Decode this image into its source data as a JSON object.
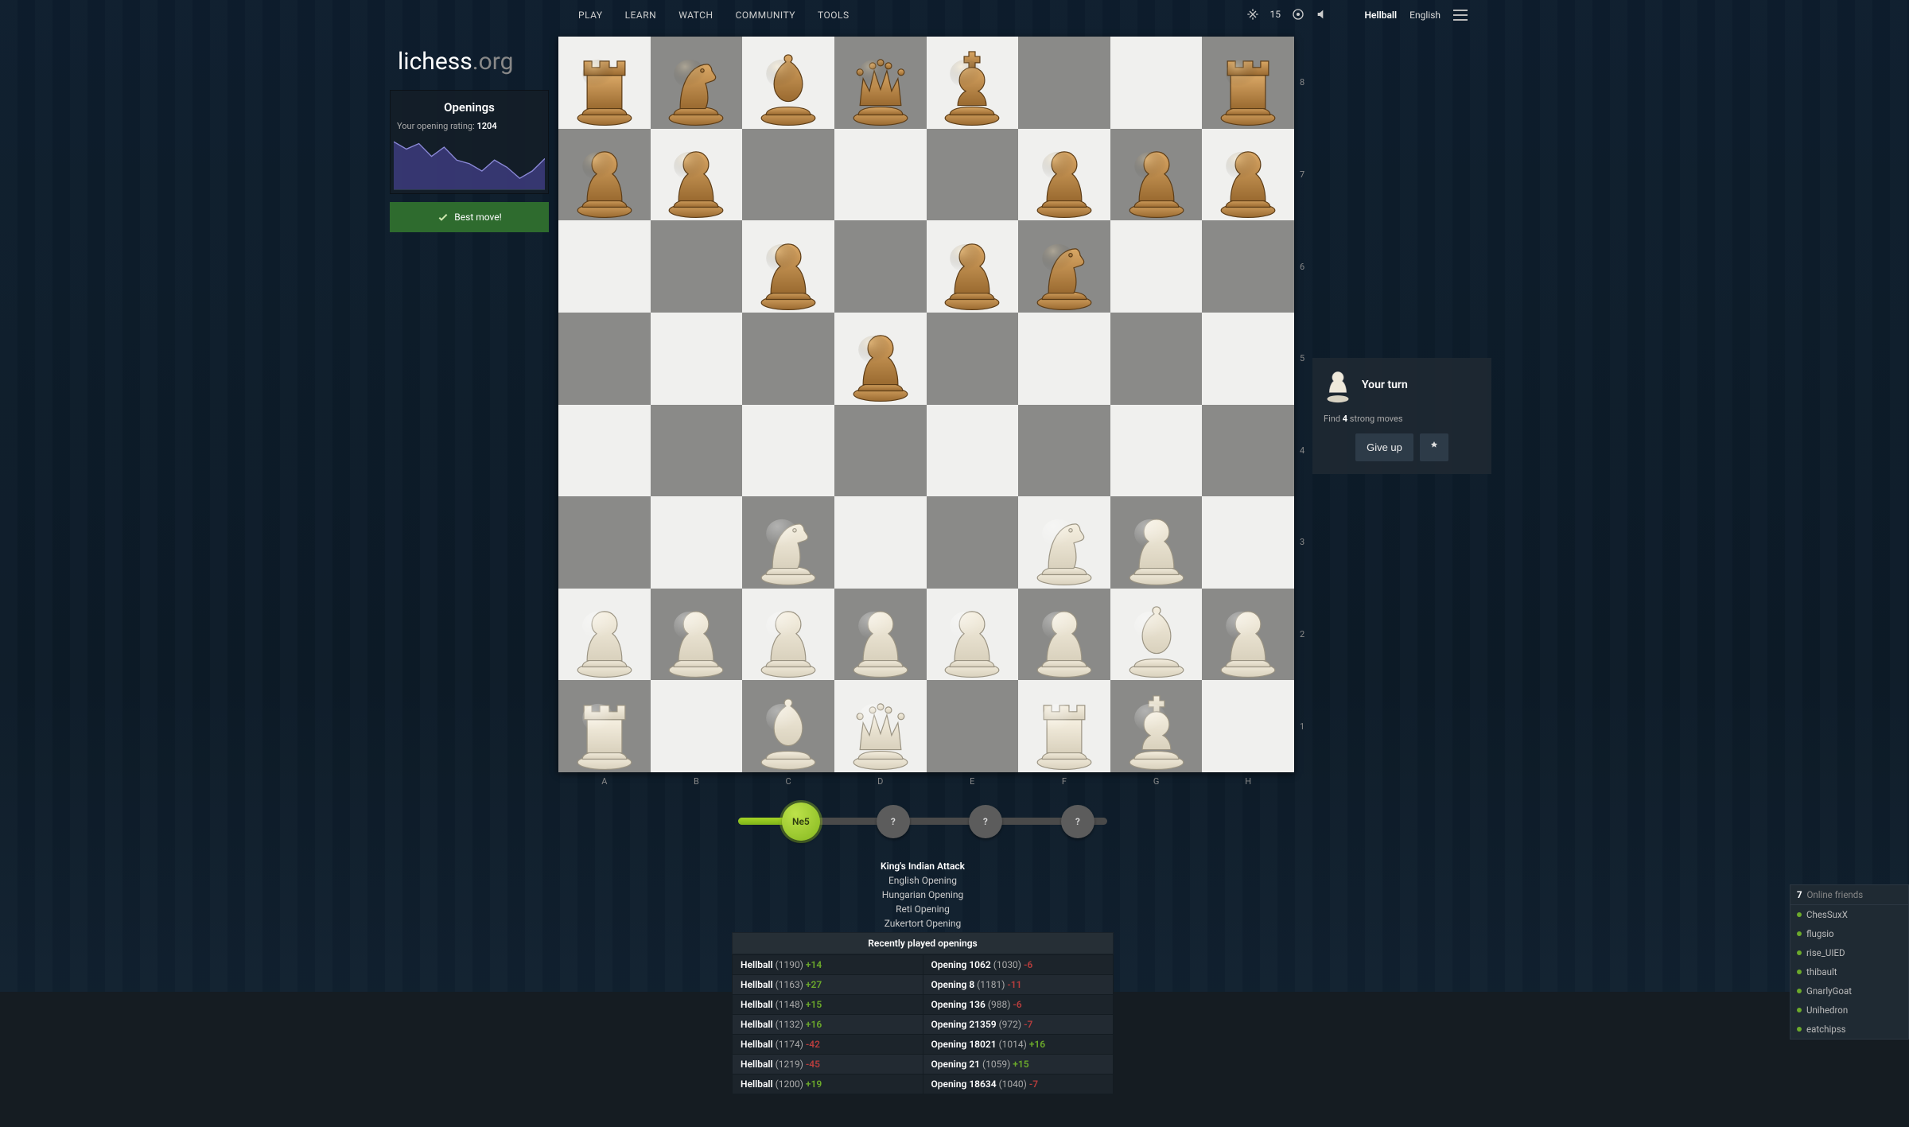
{
  "nav": {
    "items": [
      "PLAY",
      "LEARN",
      "WATCH",
      "COMMUNITY",
      "TOOLS"
    ],
    "challenges": "15",
    "username": "Hellball",
    "language": "English"
  },
  "logo": {
    "main": "lichess",
    "suffix": ".org"
  },
  "left": {
    "title": "Openings",
    "rating_label": "Your opening rating: ",
    "rating_value": "1204",
    "bestmove": "Best move!"
  },
  "board": {
    "files": [
      "A",
      "B",
      "C",
      "D",
      "E",
      "F",
      "G",
      "H"
    ],
    "ranks": [
      "8",
      "7",
      "6",
      "5",
      "4",
      "3",
      "2",
      "1"
    ],
    "position_fen": "rnbqk2r/pp3ppp/2p1pn2/3p4/8/2N2NP1/PPPPPPBP/R1BQ1RK1",
    "pieces": [
      {
        "t": "r",
        "c": "b",
        "sq": "a8"
      },
      {
        "t": "n",
        "c": "b",
        "sq": "b8"
      },
      {
        "t": "b",
        "c": "b",
        "sq": "c8"
      },
      {
        "t": "q",
        "c": "b",
        "sq": "d8"
      },
      {
        "t": "k",
        "c": "b",
        "sq": "e8"
      },
      {
        "t": "r",
        "c": "b",
        "sq": "h8"
      },
      {
        "t": "p",
        "c": "b",
        "sq": "a7"
      },
      {
        "t": "p",
        "c": "b",
        "sq": "b7"
      },
      {
        "t": "p",
        "c": "b",
        "sq": "f7"
      },
      {
        "t": "p",
        "c": "b",
        "sq": "g7"
      },
      {
        "t": "p",
        "c": "b",
        "sq": "h7"
      },
      {
        "t": "p",
        "c": "b",
        "sq": "c6"
      },
      {
        "t": "p",
        "c": "b",
        "sq": "e6"
      },
      {
        "t": "n",
        "c": "b",
        "sq": "f6"
      },
      {
        "t": "p",
        "c": "b",
        "sq": "d5"
      },
      {
        "t": "n",
        "c": "w",
        "sq": "c3"
      },
      {
        "t": "n",
        "c": "w",
        "sq": "f3"
      },
      {
        "t": "p",
        "c": "w",
        "sq": "g3"
      },
      {
        "t": "p",
        "c": "w",
        "sq": "a2"
      },
      {
        "t": "p",
        "c": "w",
        "sq": "b2"
      },
      {
        "t": "p",
        "c": "w",
        "sq": "c2"
      },
      {
        "t": "p",
        "c": "w",
        "sq": "d2"
      },
      {
        "t": "p",
        "c": "w",
        "sq": "e2"
      },
      {
        "t": "p",
        "c": "w",
        "sq": "f2"
      },
      {
        "t": "b",
        "c": "w",
        "sq": "g2"
      },
      {
        "t": "p",
        "c": "w",
        "sq": "h2"
      },
      {
        "t": "r",
        "c": "w",
        "sq": "a1"
      },
      {
        "t": "b",
        "c": "w",
        "sq": "c1"
      },
      {
        "t": "q",
        "c": "w",
        "sq": "d1"
      },
      {
        "t": "r",
        "c": "w",
        "sq": "f1"
      },
      {
        "t": "k",
        "c": "w",
        "sq": "g1"
      }
    ]
  },
  "right": {
    "turn": "Your turn",
    "find_pre": "Find ",
    "find_n": "4",
    "find_post": " strong moves",
    "giveup": "Give up"
  },
  "progress": {
    "nodes": [
      "Ne5",
      "?",
      "?",
      "?"
    ],
    "done_index": 0
  },
  "openings": [
    "King's Indian Attack",
    "English Opening",
    "Hungarian Opening",
    "Reti Opening",
    "Zukertort Opening"
  ],
  "recent": {
    "title": "Recently played openings",
    "rows": [
      {
        "l_who": "Hellball",
        "l_rat": "(1190)",
        "l_delta": "+14",
        "r_who": "Opening 1062",
        "r_rat": "(1030)",
        "r_delta": "-6"
      },
      {
        "l_who": "Hellball",
        "l_rat": "(1163)",
        "l_delta": "+27",
        "r_who": "Opening 8",
        "r_rat": "(1181)",
        "r_delta": "-11"
      },
      {
        "l_who": "Hellball",
        "l_rat": "(1148)",
        "l_delta": "+15",
        "r_who": "Opening 136",
        "r_rat": "(988)",
        "r_delta": "-6"
      },
      {
        "l_who": "Hellball",
        "l_rat": "(1132)",
        "l_delta": "+16",
        "r_who": "Opening 21359",
        "r_rat": "(972)",
        "r_delta": "-7"
      },
      {
        "l_who": "Hellball",
        "l_rat": "(1174)",
        "l_delta": "-42",
        "r_who": "Opening 18021",
        "r_rat": "(1014)",
        "r_delta": "+16"
      },
      {
        "l_who": "Hellball",
        "l_rat": "(1219)",
        "l_delta": "-45",
        "r_who": "Opening 21",
        "r_rat": "(1059)",
        "r_delta": "+15"
      },
      {
        "l_who": "Hellball",
        "l_rat": "(1200)",
        "l_delta": "+19",
        "r_who": "Opening 18634",
        "r_rat": "(1040)",
        "r_delta": "-7"
      }
    ]
  },
  "friends": {
    "count": "7",
    "label": "Online friends",
    "list": [
      "ChesSuxX",
      "flugsio",
      "rise_UIED",
      "thibault",
      "GnarlyGoat",
      "Unihedron",
      "eatchipss"
    ]
  },
  "chart_data": {
    "type": "area",
    "title": "Opening rating trend",
    "x": [
      0,
      1,
      2,
      3,
      4,
      5,
      6,
      7,
      8,
      9,
      10,
      11,
      12
    ],
    "values": [
      1250,
      1230,
      1245,
      1210,
      1235,
      1200,
      1190,
      1170,
      1200,
      1180,
      1150,
      1170,
      1204
    ],
    "ylim": [
      1120,
      1270
    ],
    "xlabel": "",
    "ylabel": ""
  }
}
